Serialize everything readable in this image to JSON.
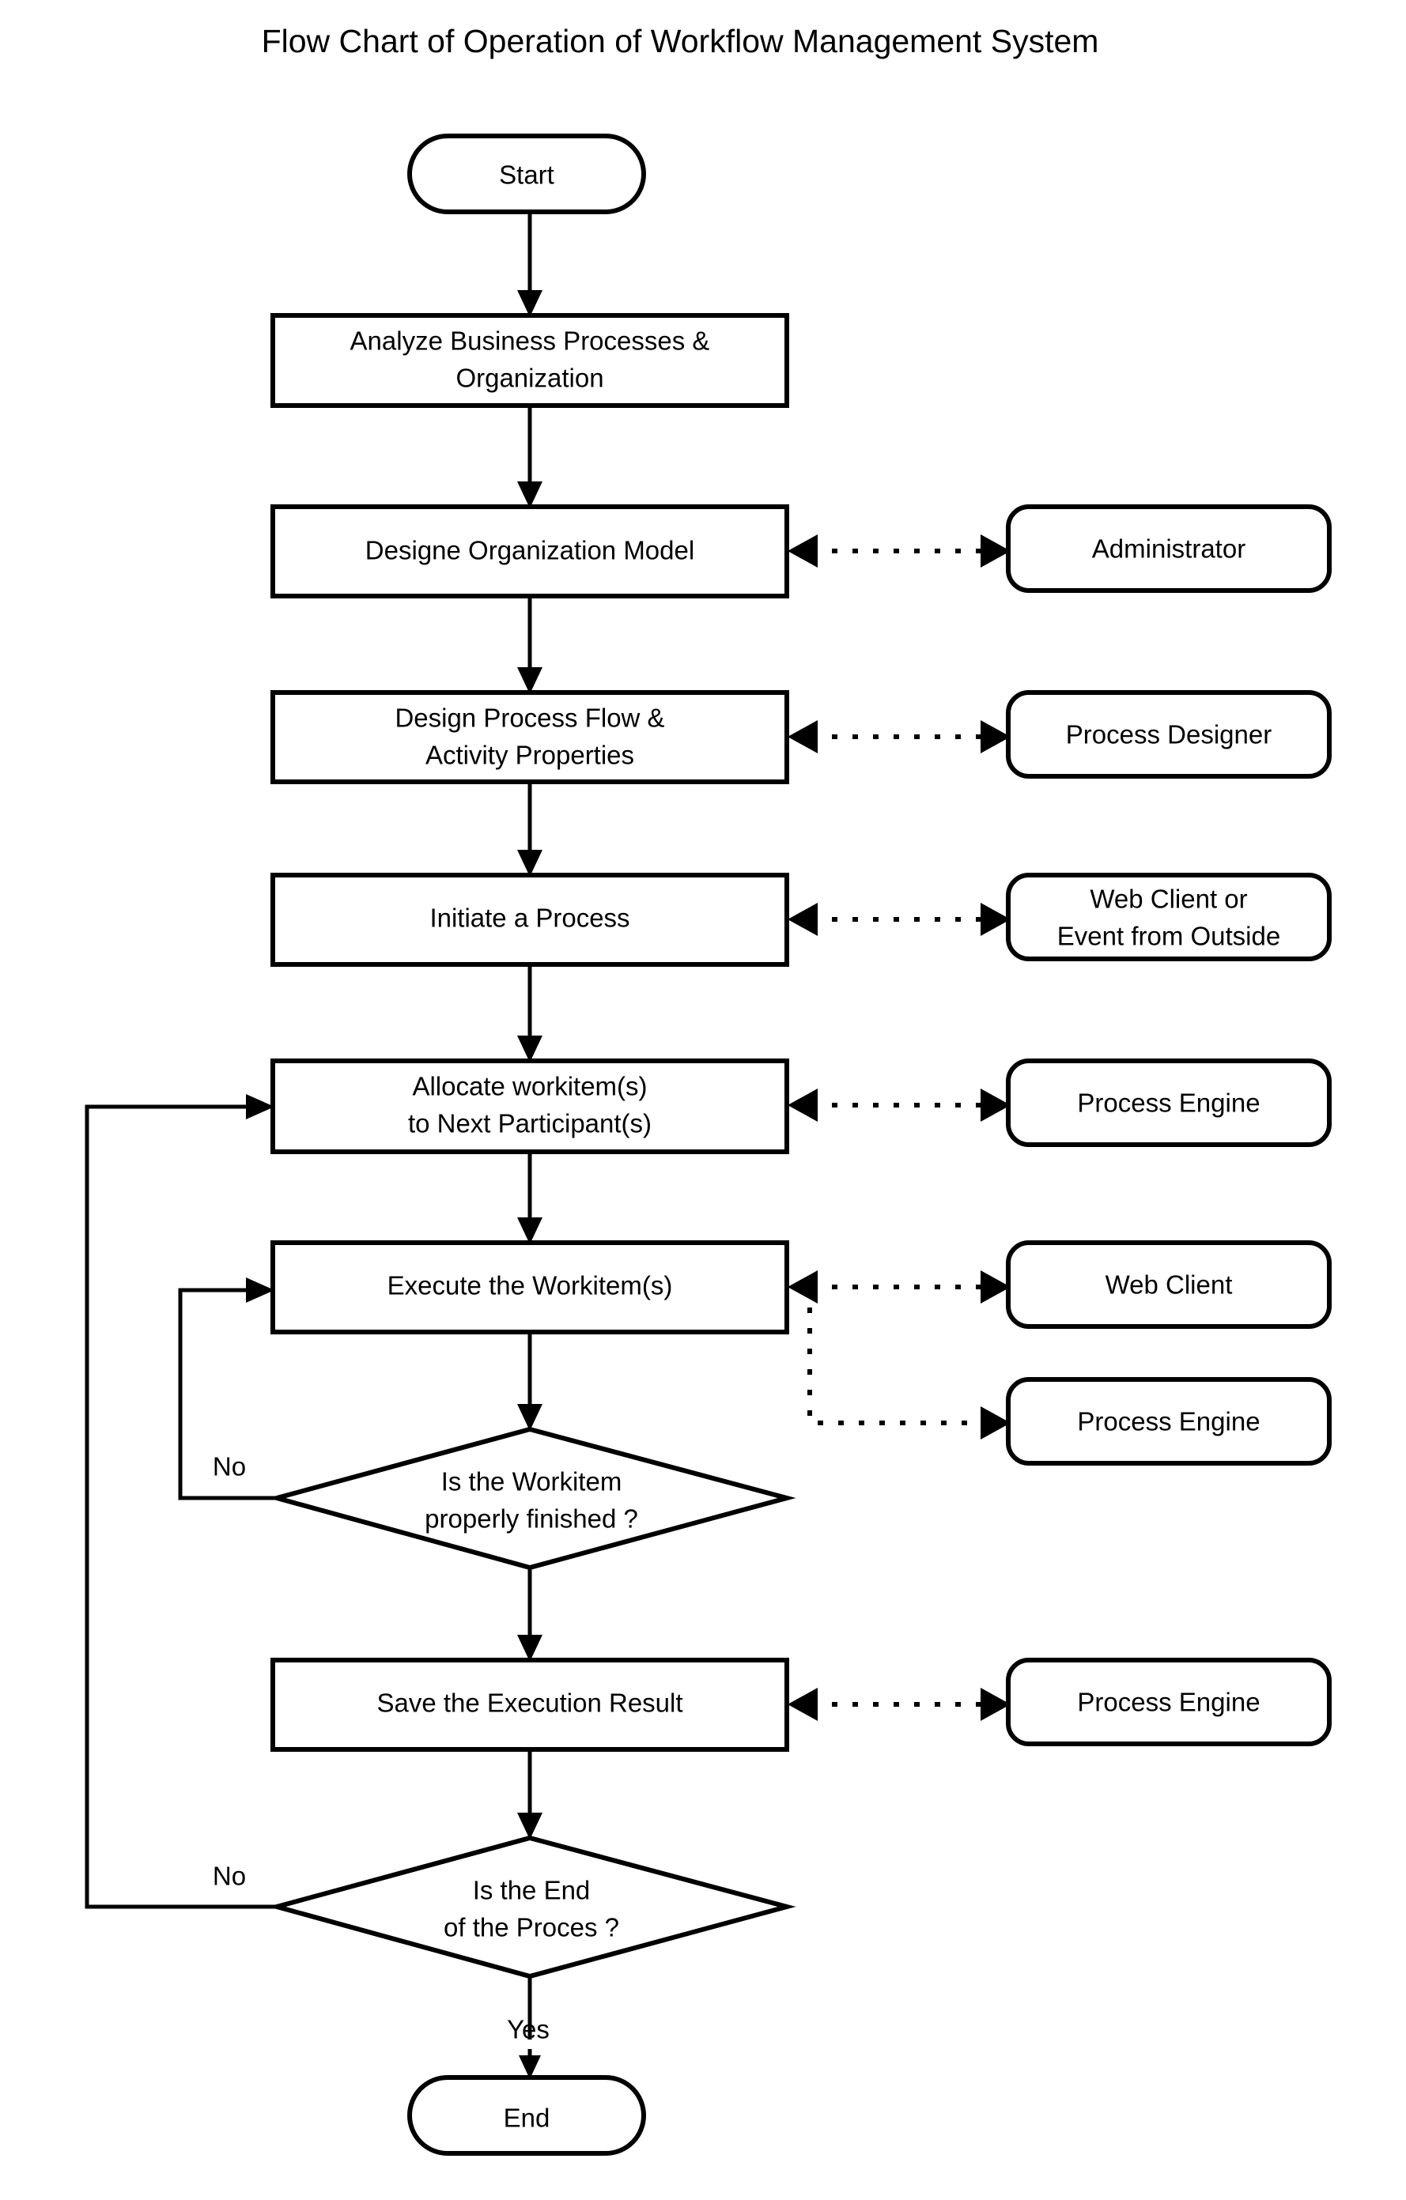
{
  "title": "Flow Chart of Operation of Workflow Management System",
  "nodes": {
    "start": "Start",
    "analyze": {
      "line1": "Analyze Business Processes &",
      "line2": "Organization"
    },
    "design_org": "Designe Organization Model",
    "design_flow": {
      "line1": "Design Process Flow &",
      "line2": "Activity Properties"
    },
    "initiate": "Initiate a Process",
    "allocate": {
      "line1": "Allocate workitem(s)",
      "line2": "to Next Participant(s)"
    },
    "execute": "Execute the Workitem(s)",
    "decision_workitem": {
      "line1": "Is the Workitem",
      "line2": "properly finished ?"
    },
    "save_result": "Save the Execution Result",
    "decision_end": {
      "line1": "Is the End",
      "line2": "of the Proces ?"
    },
    "end": "End"
  },
  "actors": {
    "administrator": "Administrator",
    "process_designer": "Process Designer",
    "web_client_or_event": {
      "line1": "Web Client or",
      "line2": "Event from Outside"
    },
    "process_engine_allocate": "Process Engine",
    "web_client": "Web Client",
    "process_engine_execute": "Process Engine",
    "process_engine_save": "Process Engine"
  },
  "branch_labels": {
    "workitem_no": "No",
    "end_no": "No",
    "end_yes": "Yes"
  },
  "colors": {
    "stroke": "#000000",
    "fill": "#ffffff",
    "background": "#ffffff"
  },
  "chart_data": {
    "type": "diagram",
    "subtype": "flowchart",
    "title": "Flow Chart of Operation of Workflow Management System",
    "orientation": "top-to-bottom",
    "nodes": [
      {
        "id": "start",
        "shape": "capsule",
        "label": "Start"
      },
      {
        "id": "analyze",
        "shape": "rectangle",
        "label": "Analyze Business Processes & Organization"
      },
      {
        "id": "design_org",
        "shape": "rectangle",
        "label": "Designe Organization Model"
      },
      {
        "id": "design_flow",
        "shape": "rectangle",
        "label": "Design Process Flow & Activity Properties"
      },
      {
        "id": "initiate",
        "shape": "rectangle",
        "label": "Initiate a Process"
      },
      {
        "id": "allocate",
        "shape": "rectangle",
        "label": "Allocate workitem(s) to Next Participant(s)"
      },
      {
        "id": "execute",
        "shape": "rectangle",
        "label": "Execute the Workitem(s)"
      },
      {
        "id": "decision_workitem",
        "shape": "diamond",
        "label": "Is the Workitem properly finished ?"
      },
      {
        "id": "save_result",
        "shape": "rectangle",
        "label": "Save the Execution Result"
      },
      {
        "id": "decision_end",
        "shape": "diamond",
        "label": "Is the End of the Proces ?"
      },
      {
        "id": "end",
        "shape": "capsule",
        "label": "End"
      },
      {
        "id": "administrator",
        "shape": "rounded",
        "label": "Administrator",
        "column": "right"
      },
      {
        "id": "process_designer",
        "shape": "rounded",
        "label": "Process Designer",
        "column": "right"
      },
      {
        "id": "web_client_or_event",
        "shape": "rounded",
        "label": "Web Client or Event from Outside",
        "column": "right"
      },
      {
        "id": "process_engine_allocate",
        "shape": "rounded",
        "label": "Process Engine",
        "column": "right"
      },
      {
        "id": "web_client",
        "shape": "rounded",
        "label": "Web Client",
        "column": "right"
      },
      {
        "id": "process_engine_execute",
        "shape": "rounded",
        "label": "Process Engine",
        "column": "right"
      },
      {
        "id": "process_engine_save",
        "shape": "rounded",
        "label": "Process Engine",
        "column": "right"
      }
    ],
    "edges": [
      {
        "from": "start",
        "to": "analyze",
        "style": "solid"
      },
      {
        "from": "analyze",
        "to": "design_org",
        "style": "solid"
      },
      {
        "from": "design_org",
        "to": "design_flow",
        "style": "solid"
      },
      {
        "from": "design_flow",
        "to": "initiate",
        "style": "solid"
      },
      {
        "from": "initiate",
        "to": "allocate",
        "style": "solid"
      },
      {
        "from": "allocate",
        "to": "execute",
        "style": "solid"
      },
      {
        "from": "execute",
        "to": "decision_workitem",
        "style": "solid"
      },
      {
        "from": "decision_workitem",
        "to": "save_result",
        "style": "solid"
      },
      {
        "from": "decision_workitem",
        "to": "execute",
        "style": "solid",
        "label": "No"
      },
      {
        "from": "save_result",
        "to": "decision_end",
        "style": "solid"
      },
      {
        "from": "decision_end",
        "to": "allocate",
        "style": "solid",
        "label": "No"
      },
      {
        "from": "decision_end",
        "to": "end",
        "style": "solid",
        "label": "Yes"
      },
      {
        "from": "design_org",
        "to": "administrator",
        "style": "dotted",
        "bidirectional": true
      },
      {
        "from": "design_flow",
        "to": "process_designer",
        "style": "dotted",
        "bidirectional": true
      },
      {
        "from": "initiate",
        "to": "web_client_or_event",
        "style": "dotted",
        "bidirectional": true
      },
      {
        "from": "allocate",
        "to": "process_engine_allocate",
        "style": "dotted",
        "bidirectional": true
      },
      {
        "from": "execute",
        "to": "web_client",
        "style": "dotted",
        "bidirectional": true
      },
      {
        "from": "execute",
        "to": "process_engine_execute",
        "style": "dotted",
        "bidirectional": true
      },
      {
        "from": "save_result",
        "to": "process_engine_save",
        "style": "dotted",
        "bidirectional": true
      }
    ]
  }
}
